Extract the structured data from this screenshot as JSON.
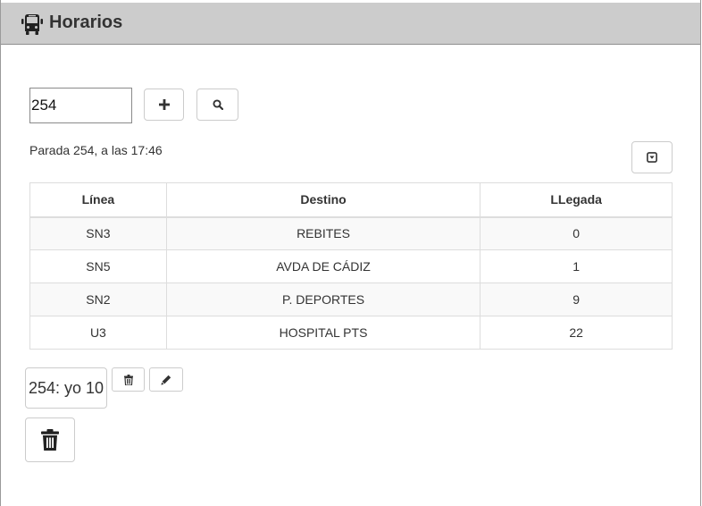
{
  "app": {
    "title": "Horarios",
    "header_icon": "bus-icon"
  },
  "search": {
    "stop_value": "254",
    "add_icon": "plus-icon",
    "search_icon": "search-icon",
    "toggle_icon": "dropdown-toggle-icon"
  },
  "status": {
    "text": "Parada 254, a las 17:46"
  },
  "table": {
    "headers": [
      "Línea",
      "Destino",
      "LLegada"
    ],
    "rows": [
      {
        "line": "SN3",
        "destination": "REBITES",
        "arrival": "0"
      },
      {
        "line": "SN5",
        "destination": "AVDA DE CÁDIZ",
        "arrival": "1"
      },
      {
        "line": "SN2",
        "destination": "P. DEPORTES",
        "arrival": "9"
      },
      {
        "line": "U3",
        "destination": "HOSPITAL PTS",
        "arrival": "22"
      }
    ]
  },
  "favorites": [
    {
      "label": "254: yo 10",
      "delete_icon": "trash-icon",
      "edit_icon": "pencil-icon"
    }
  ],
  "clear_all": {
    "icon": "trash-icon"
  },
  "colors": {
    "header_bg": "#cccccc",
    "text": "#333333",
    "border": "#dddddd",
    "stripe": "#f9f9f9"
  }
}
